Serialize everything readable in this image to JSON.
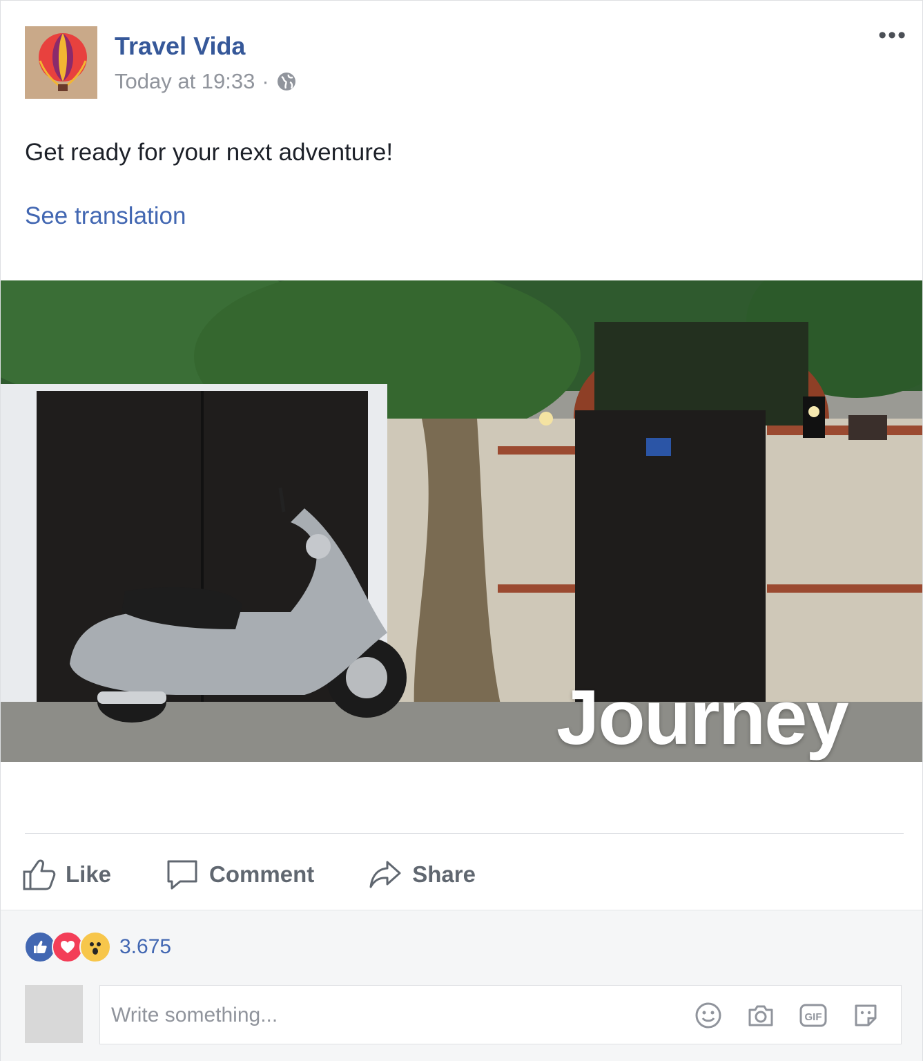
{
  "page": {
    "name": "Travel Vida",
    "timestamp": "Today at 19:33",
    "separator": "·",
    "audience_icon": "globe-icon",
    "more_icon_label": "•••"
  },
  "post": {
    "text": "Get ready for your next adventure!",
    "see_translation": "See translation",
    "photo_overlay_text": "Journey"
  },
  "actions": {
    "like": "Like",
    "comment": "Comment",
    "share": "Share"
  },
  "reactions": {
    "types": [
      "like-icon",
      "love-icon",
      "wow-icon"
    ],
    "count": "3.675"
  },
  "comment_box": {
    "placeholder": "Write something...",
    "tools": [
      "emoji-icon",
      "camera-icon",
      "gif-icon",
      "sticker-icon"
    ]
  },
  "colors": {
    "link": "#365899",
    "action_text": "#606770",
    "like_blue": "#4267b2",
    "love_red": "#f33e58",
    "wow_yellow": "#f7c64b"
  }
}
